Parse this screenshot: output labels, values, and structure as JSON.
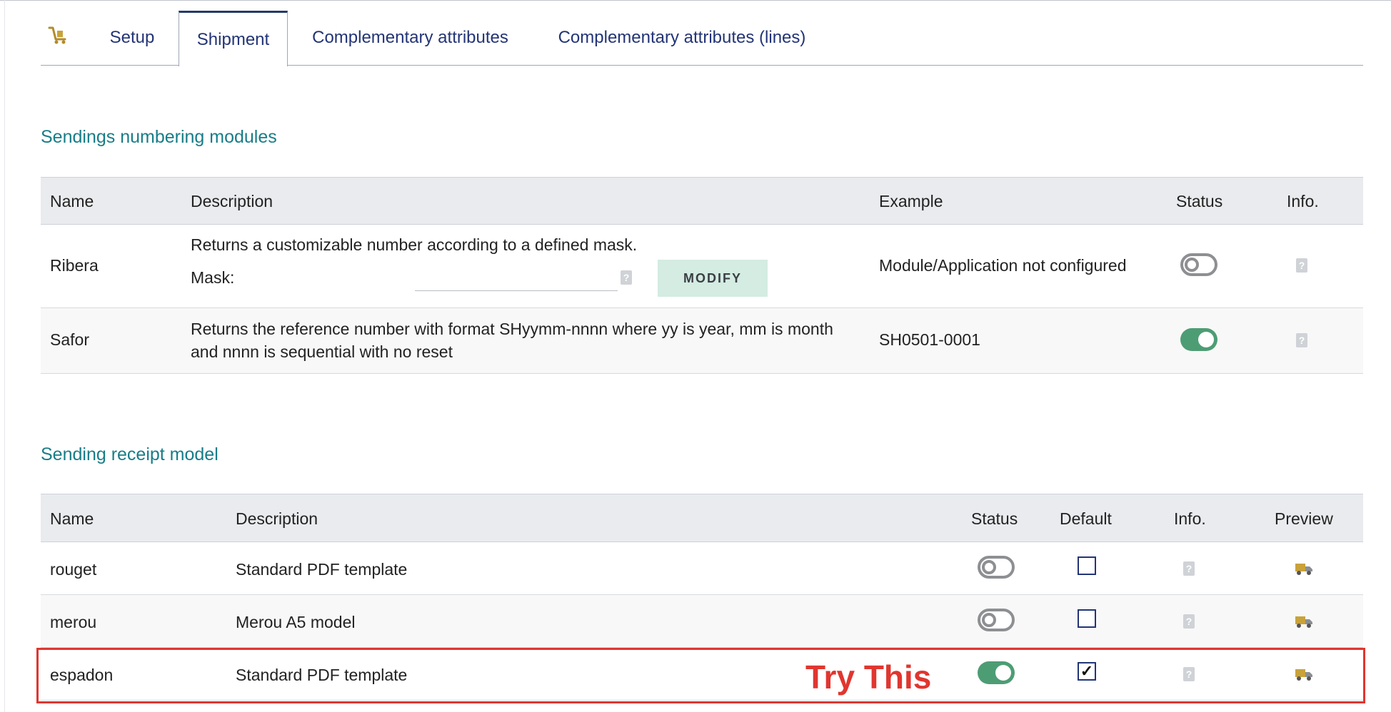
{
  "tabs": {
    "icon": "shipment-cart-icon",
    "items": [
      "Setup",
      "Shipment",
      "Complementary attributes",
      "Complementary attributes (lines)"
    ],
    "active": "Shipment"
  },
  "numbering": {
    "title": "Sendings numbering modules",
    "headers": {
      "name": "Name",
      "description": "Description",
      "example": "Example",
      "status": "Status",
      "info": "Info."
    },
    "rows": [
      {
        "name": "Ribera",
        "description": "Returns a customizable number according to a defined mask.",
        "mask_label": "Mask:",
        "mask_value": "",
        "modify_label": "MODIFY",
        "example": "Module/Application not configured",
        "status": "off"
      },
      {
        "name": "Safor",
        "description_line1": "Returns the reference number with format SHyymm-nnnn where yy is year, mm is month",
        "description_line2": "and nnnn is sequential with no reset",
        "example": "SH0501-0001",
        "status": "on"
      }
    ]
  },
  "receipt": {
    "title": "Sending receipt model",
    "headers": {
      "name": "Name",
      "description": "Description",
      "status": "Status",
      "default": "Default",
      "info": "Info.",
      "preview": "Preview"
    },
    "rows": [
      {
        "name": "rouget",
        "description": "Standard PDF template",
        "status": "off",
        "default": false
      },
      {
        "name": "merou",
        "description": "Merou A5 model",
        "status": "off",
        "default": false
      },
      {
        "name": "espadon",
        "description": "Standard PDF template",
        "status": "on",
        "default": true
      }
    ]
  },
  "annotation": {
    "text": "Try This",
    "color": "#e0362f"
  },
  "colors": {
    "accent": "#187d87",
    "tab_text": "#233476",
    "toggle_on": "#4d9d74",
    "toggle_off": "#8d8f92"
  }
}
